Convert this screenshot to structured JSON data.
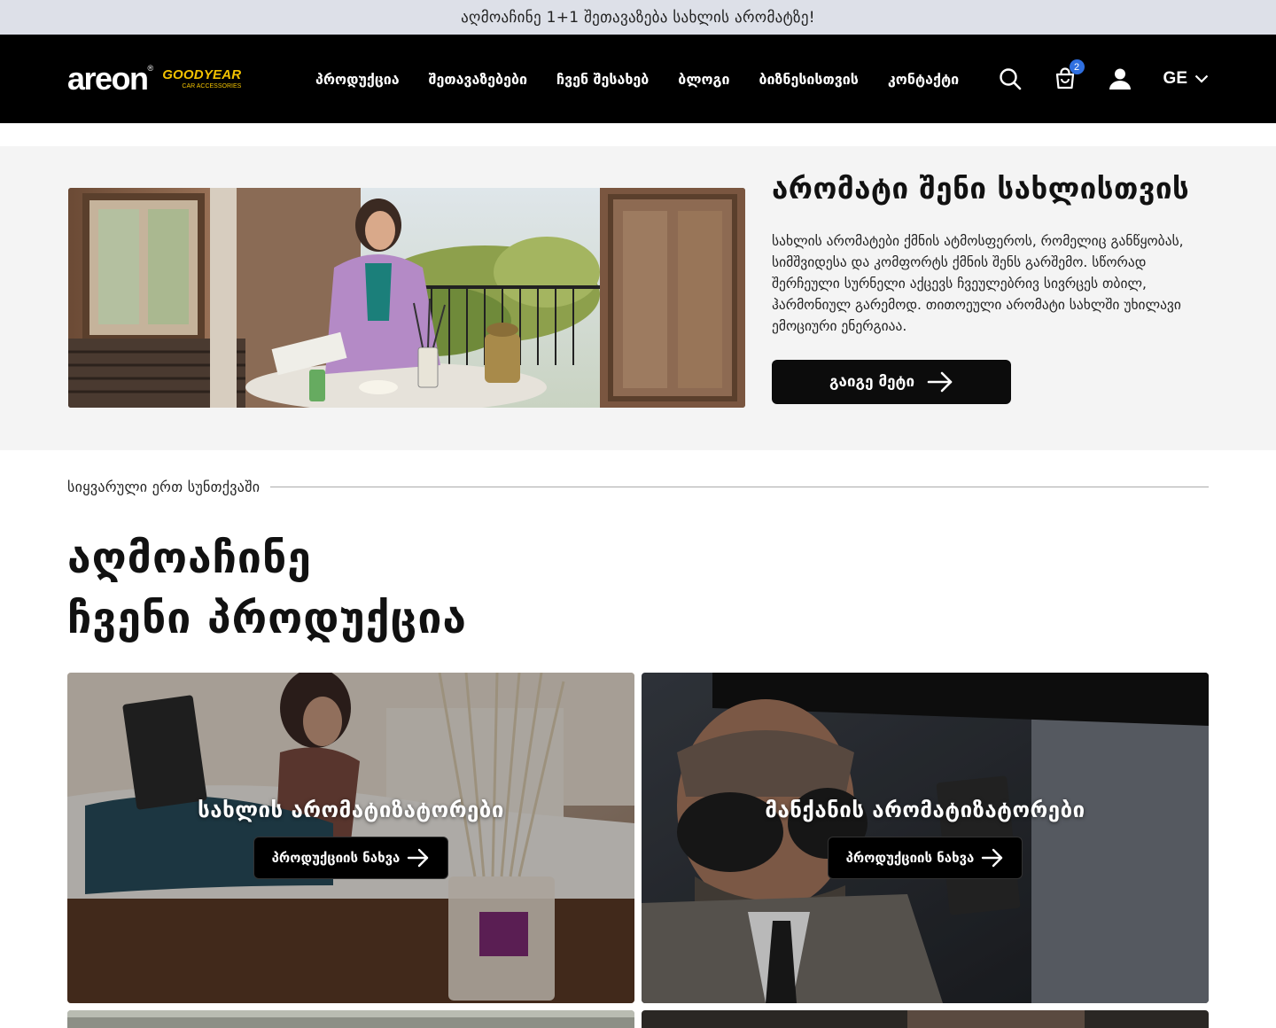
{
  "promo": {
    "text": "აღმოაჩინე 1+1 შეთავაზება სახლის არომატზე!"
  },
  "header": {
    "logo_areon": "areon",
    "logo_goodyear": "GOODYEAR",
    "logo_goodyear_sub": "CAR ACCESSORIES",
    "nav": [
      "პროდუქცია",
      "შეთავაზებები",
      "ჩვენ შესახებ",
      "ბლოგი",
      "ბიზნესისთვის",
      "კონტაქტი"
    ],
    "cart_count": "2",
    "language": "GE",
    "icons": [
      "search-icon",
      "cart-icon",
      "user-icon",
      "chevron-down-icon"
    ]
  },
  "hero": {
    "title": "არომატი შენი სახლისთვის",
    "description": "სახლის არომატები ქმნის ატმოსფეროს, რომელიც განწყობას, სიმშვიდესა და კომფორტს ქმნის შენს გარშემო. სწორად შერჩეული სურნელი აქცევს ჩვეულებრივ სივრცეს თბილ, ჰარმონიულ გარემოდ. თითოეული არომატი სახლში უხილავი ემოციური ენერგიაა.",
    "button_label": "გაიგე მეტი"
  },
  "products_section": {
    "label": "სიყვარული ერთ სუნთქვაში",
    "title_line1": "აღმოაჩინე",
    "title_line2": "ჩვენი პროდუქცია",
    "cards": [
      {
        "title": "სახლის არომატიზატორები",
        "button_label": "პროდუქციის ნახვა"
      },
      {
        "title": "მანქანის არომატიზატორები",
        "button_label": "პროდუქციის ნახვა"
      }
    ]
  },
  "colors": {
    "header_bg": "#000000",
    "promo_bg": "#dde0e8",
    "badge": "#2f6fe0",
    "button_bg": "#0c0c0c"
  }
}
